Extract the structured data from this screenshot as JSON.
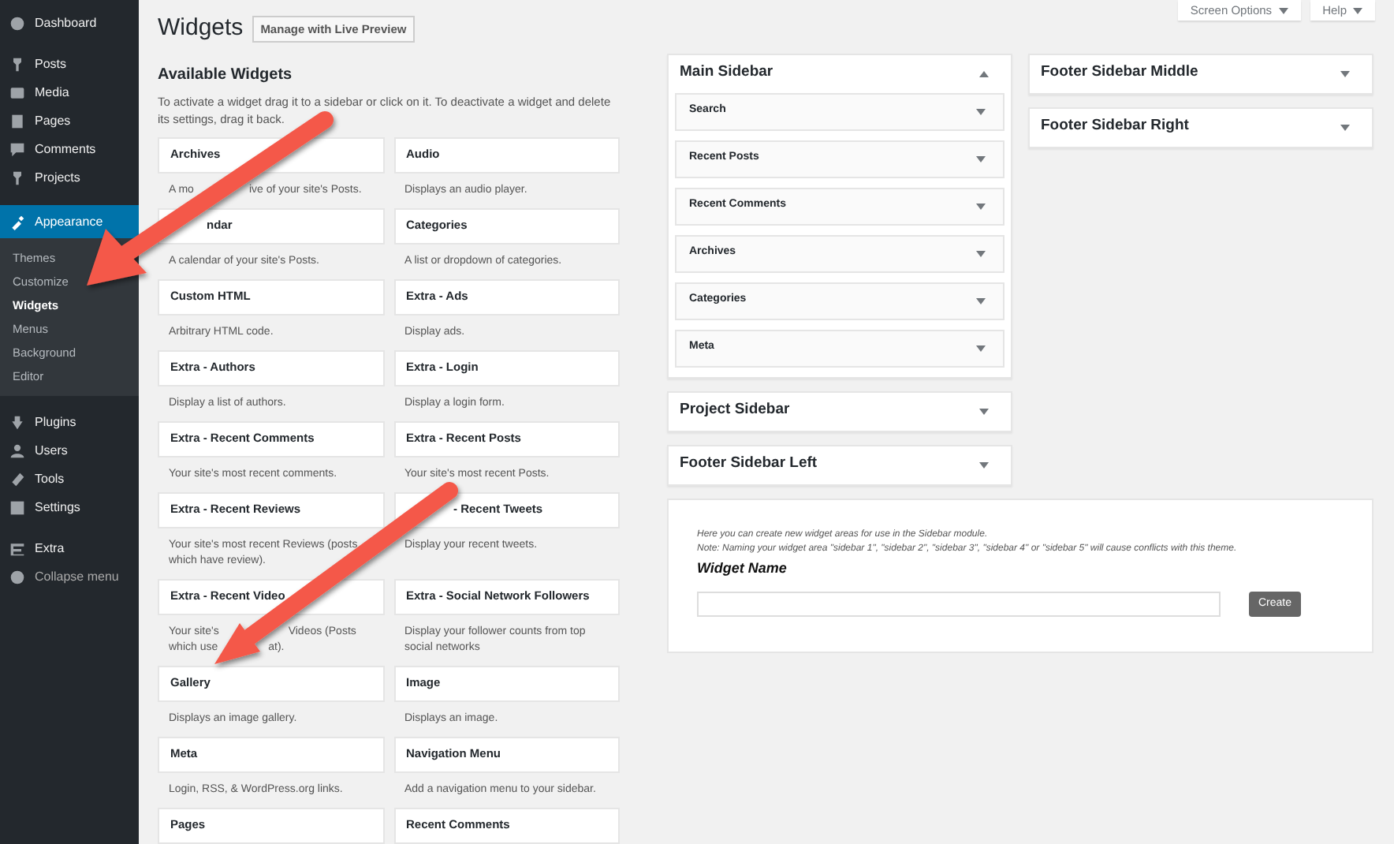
{
  "admin_menu": [
    {
      "label": "Dashboard",
      "selected": false
    },
    {
      "label": "Posts",
      "selected": false
    },
    {
      "label": "Media",
      "selected": false
    },
    {
      "label": "Pages",
      "selected": false
    },
    {
      "label": "Comments",
      "selected": false
    },
    {
      "label": "Projects",
      "selected": false
    },
    {
      "label": "Appearance",
      "selected": true,
      "children": [
        {
          "label": "Themes",
          "selected": false
        },
        {
          "label": "Customize",
          "selected": false
        },
        {
          "label": "Widgets",
          "selected": true
        },
        {
          "label": "Menus",
          "selected": false
        },
        {
          "label": "Background",
          "selected": false
        },
        {
          "label": "Editor",
          "selected": false
        }
      ]
    },
    {
      "label": "Plugins",
      "selected": false
    },
    {
      "label": "Users",
      "selected": false
    },
    {
      "label": "Tools",
      "selected": false
    },
    {
      "label": "Settings",
      "selected": false
    },
    {
      "label": "Extra",
      "selected": false
    },
    {
      "label": "Collapse menu",
      "selected": false
    }
  ],
  "page_title": "Widgets",
  "live_preview_button": "Manage with Live Preview",
  "screen_options_button": "Screen Options",
  "help_button": "Help",
  "available_widgets": {
    "title": "Available Widgets",
    "description": "To activate a widget drag it to a sidebar or click on it. To deactivate a widget and delete its settings, drag it back.",
    "widgets": [
      {
        "name": "Archives",
        "description": [
          [
            "A mo",
            "ive of your site's Posts."
          ]
        ]
      },
      {
        "name": "Audio",
        "description": "Displays an audio player."
      },
      {
        "name": "ndar",
        "description": "A calendar of your site's Posts."
      },
      {
        "name": "Categories",
        "description": "A list or dropdown of categories."
      },
      {
        "name": "Custom HTML",
        "description": "Arbitrary HTML code."
      },
      {
        "name": "Extra - Ads",
        "description": "Display ads."
      },
      {
        "name": "Extra - Authors",
        "description": "Display a list of authors."
      },
      {
        "name": "Extra - Login",
        "description": "Display a login form."
      },
      {
        "name": "Extra - Recent Comments",
        "description": "Your site's most recent comments."
      },
      {
        "name": "Extra - Recent Posts",
        "description": "Your site's most recent Posts."
      },
      {
        "name": "Extra - Recent Reviews",
        "description": "Your site's most recent Reviews (posts which have review)."
      },
      {
        "name": "- Recent Tweets",
        "description": "Display your recent tweets."
      },
      {
        "name": "Extra - Recent Video",
        "description": [
          [
            "Your site's",
            "Videos (Posts"
          ],
          [
            "which use",
            "at)."
          ]
        ]
      },
      {
        "name": "Extra - Social Network Followers",
        "description": "Display your follower counts from top social networks"
      },
      {
        "name": "Gallery",
        "description": "Displays an image gallery."
      },
      {
        "name": "Image",
        "description": "Displays an image."
      },
      {
        "name": "Meta",
        "description": "Login, RSS, & WordPress.org links."
      },
      {
        "name": "Navigation Menu",
        "description": "Add a navigation menu to your sidebar."
      },
      {
        "name": "Pages"
      },
      {
        "name": "Recent Comments"
      }
    ]
  },
  "sidebar_columns": [
    {
      "sidebars": [
        {
          "title": "Main Sidebar",
          "expanded": true,
          "widgets": [
            "Search",
            "Recent Posts",
            "Recent Comments",
            "Archives",
            "Categories",
            "Meta"
          ]
        },
        {
          "title": "Project Sidebar",
          "expanded": false
        },
        {
          "title": "Footer Sidebar Left",
          "expanded": false
        }
      ]
    },
    {
      "sidebars": [
        {
          "title": "Footer Sidebar Middle",
          "expanded": false
        },
        {
          "title": "Footer Sidebar Right",
          "expanded": false
        }
      ]
    }
  ],
  "create_area": {
    "intro": "Here you can create new widget areas for use in the Sidebar module.",
    "note": "Note: Naming your widget area \"sidebar 1\", \"sidebar 2\", \"sidebar 3\", \"sidebar 4\" or \"sidebar 5\" will cause conflicts with this theme.",
    "label": "Widget Name",
    "button": "Create"
  }
}
